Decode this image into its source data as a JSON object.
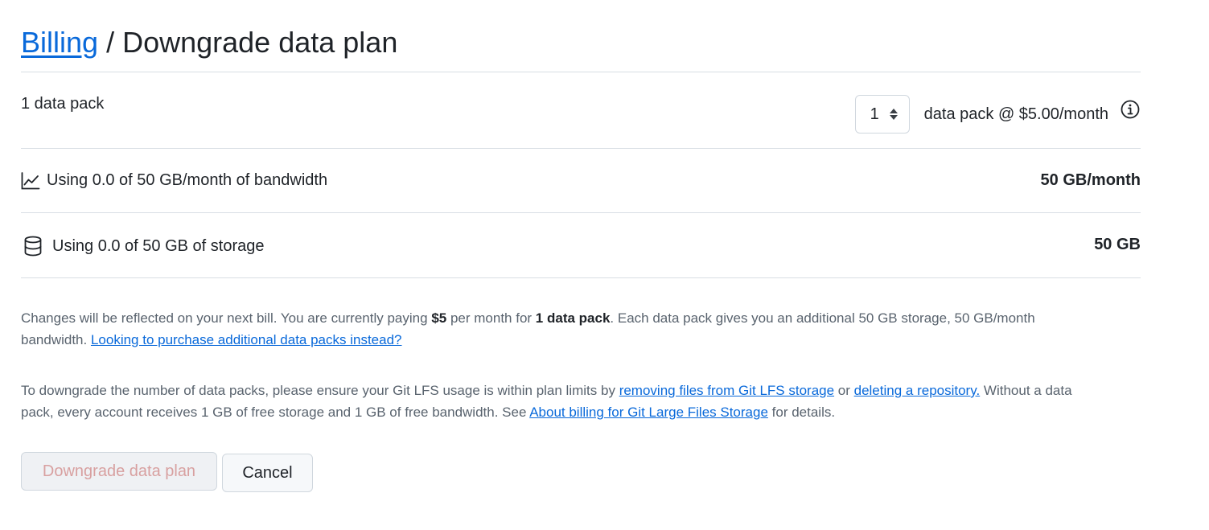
{
  "header": {
    "breadcrumb_link": "Billing",
    "separator": "/",
    "title": "Downgrade data plan"
  },
  "data_pack": {
    "summary": "1 data pack",
    "quantity": "1",
    "price_label": "data pack @ $5.00/month",
    "info_icon": "info-icon"
  },
  "bandwidth": {
    "icon": "graph-icon",
    "label": "Using 0.0 of 50 GB/month of bandwidth",
    "limit": "50 GB/month"
  },
  "storage": {
    "icon": "database-icon",
    "label": "Using 0.0 of 50 GB of storage",
    "limit": "50 GB"
  },
  "notice": {
    "p1_a": "Changes will be reflected on your next bill. You are currently paying ",
    "p1_price": "$5",
    "p1_b": " per month for ",
    "p1_packs": "1 data pack",
    "p1_c": ". Each data pack gives you an additional 50 GB storage, 50 GB/month bandwidth. ",
    "p1_link": "Looking to purchase additional data packs instead?",
    "p2_a": "To downgrade the number of data packs, please ensure your Git LFS usage is within plan limits by ",
    "p2_link1": "removing files from Git LFS storage",
    "p2_b": " or ",
    "p2_link2": "deleting a repository.",
    "p2_c": " Without a data pack, every account receives 1 GB of free storage and 1 GB of free bandwidth. See ",
    "p2_link3": "About billing for Git Large Files Storage",
    "p2_d": " for details."
  },
  "actions": {
    "downgrade_label": "Downgrade data plan",
    "cancel_label": "Cancel"
  },
  "colors": {
    "link": "#0969da",
    "border": "#d8dee4",
    "disabled_text": "#d8a0a0"
  }
}
